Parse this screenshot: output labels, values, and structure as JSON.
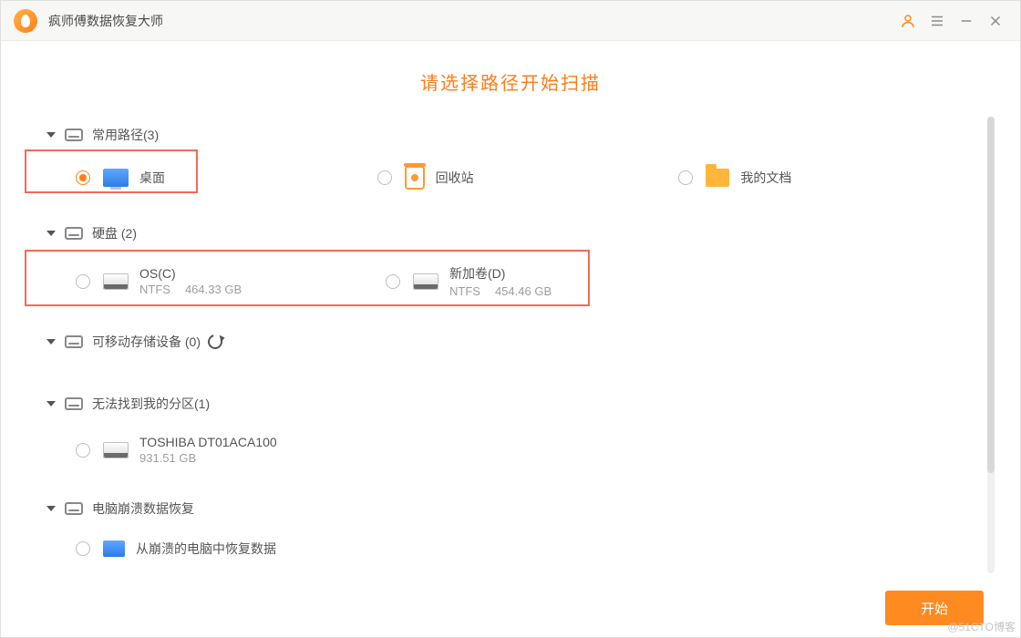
{
  "app_title": "疯师傅数据恢复大师",
  "page_heading": "请选择路径开始扫描",
  "sections": {
    "common": {
      "title": "常用路径(3)"
    },
    "disks": {
      "title": "硬盘 (2)"
    },
    "removable": {
      "title": "可移动存储设备 (0)"
    },
    "lost": {
      "title": "无法找到我的分区(1)"
    },
    "crash": {
      "title": "电脑崩溃数据恢复"
    }
  },
  "common_items": {
    "desktop": "桌面",
    "recycle": "回收站",
    "documents": "我的文档"
  },
  "drives": [
    {
      "name": "OS(C)",
      "fs": "NTFS",
      "size": "464.33 GB"
    },
    {
      "name": "新加卷(D)",
      "fs": "NTFS",
      "size": "454.46 GB"
    }
  ],
  "lost_items": [
    {
      "name": "TOSHIBA DT01ACA100",
      "size": "931.51 GB"
    }
  ],
  "crash_items": {
    "recover": "从崩溃的电脑中恢复数据"
  },
  "start_button": "开始",
  "watermark": "@51CTO博客"
}
